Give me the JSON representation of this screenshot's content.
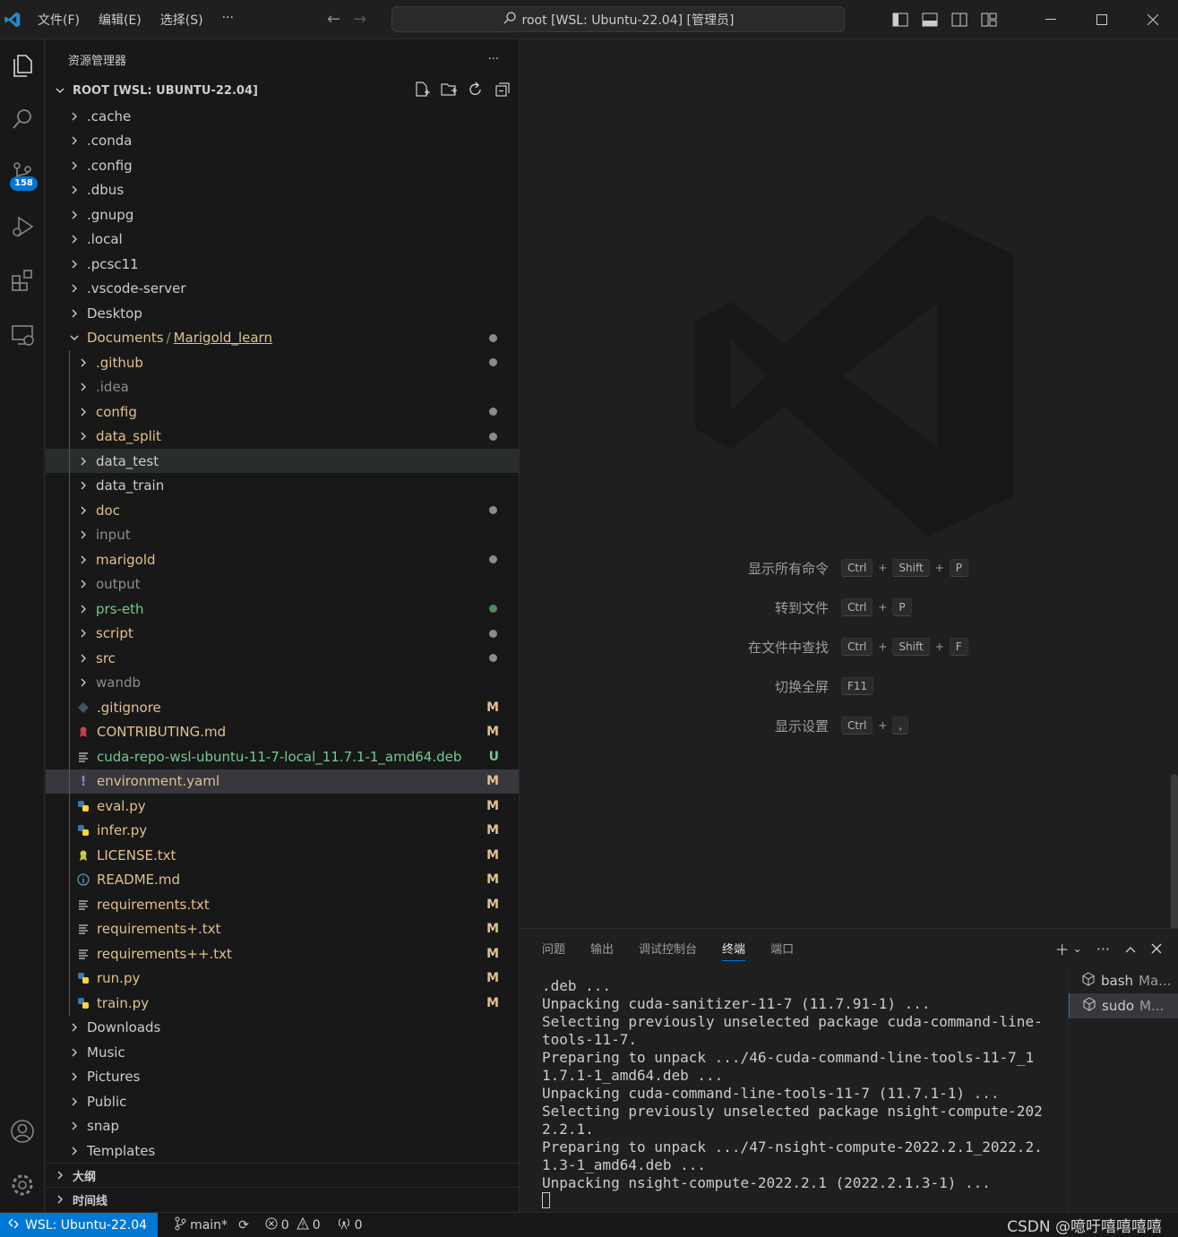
{
  "titlebar": {
    "menus": [
      "文件(F)",
      "编辑(E)",
      "选择(S)",
      "···"
    ],
    "search_text": "root [WSL: Ubuntu-22.04] [管理员]"
  },
  "activity": {
    "scm_badge": "158"
  },
  "explorer": {
    "header": "资源管理器",
    "more": "···",
    "root_label": "ROOT [WSL: UBUNTU-22.04]",
    "items": [
      {
        "label": ".cache",
        "kind": "folder",
        "indent": 0,
        "color": "#cccccc"
      },
      {
        "label": ".conda",
        "kind": "folder",
        "indent": 0,
        "color": "#cccccc"
      },
      {
        "label": ".config",
        "kind": "folder",
        "indent": 0,
        "color": "#cccccc"
      },
      {
        "label": ".dbus",
        "kind": "folder",
        "indent": 0,
        "color": "#cccccc"
      },
      {
        "label": ".gnupg",
        "kind": "folder",
        "indent": 0,
        "color": "#cccccc"
      },
      {
        "label": ".local",
        "kind": "folder",
        "indent": 0,
        "color": "#cccccc"
      },
      {
        "label": ".pcsc11",
        "kind": "folder",
        "indent": 0,
        "color": "#cccccc"
      },
      {
        "label": ".vscode-server",
        "kind": "folder",
        "indent": 0,
        "color": "#cccccc"
      },
      {
        "label": "Desktop",
        "kind": "folder",
        "indent": 0,
        "color": "#cccccc"
      },
      {
        "label": "Documents",
        "label2": "Marigold_learn",
        "kind": "folder-open",
        "indent": 0,
        "color": "#e2c08d",
        "dot": "#8b8b8b"
      },
      {
        "label": ".github",
        "kind": "folder",
        "indent": 1,
        "color": "#e2c08d",
        "dot": "#8b8b8b"
      },
      {
        "label": ".idea",
        "kind": "folder",
        "indent": 1,
        "color": "#8c8c8c"
      },
      {
        "label": "config",
        "kind": "folder",
        "indent": 1,
        "color": "#e2c08d",
        "dot": "#8b8b8b"
      },
      {
        "label": "data_split",
        "kind": "folder",
        "indent": 1,
        "color": "#e2c08d",
        "dot": "#8b8b8b"
      },
      {
        "label": "data_test",
        "kind": "folder",
        "indent": 1,
        "color": "#cccccc",
        "selected": true
      },
      {
        "label": "data_train",
        "kind": "folder",
        "indent": 1,
        "color": "#cccccc"
      },
      {
        "label": "doc",
        "kind": "folder",
        "indent": 1,
        "color": "#e2c08d",
        "dot": "#8b8b8b"
      },
      {
        "label": "input",
        "kind": "folder",
        "indent": 1,
        "color": "#8c8c8c"
      },
      {
        "label": "marigold",
        "kind": "folder",
        "indent": 1,
        "color": "#e2c08d",
        "dot": "#8b8b8b"
      },
      {
        "label": "output",
        "kind": "folder",
        "indent": 1,
        "color": "#8c8c8c"
      },
      {
        "label": "prs-eth",
        "kind": "folder",
        "indent": 1,
        "color": "#73c991",
        "dot": "#4e8a5b"
      },
      {
        "label": "script",
        "kind": "folder",
        "indent": 1,
        "color": "#e2c08d",
        "dot": "#8b8b8b"
      },
      {
        "label": "src",
        "kind": "folder",
        "indent": 1,
        "color": "#e2c08d",
        "dot": "#8b8b8b"
      },
      {
        "label": "wandb",
        "kind": "folder",
        "indent": 1,
        "color": "#8c8c8c"
      },
      {
        "label": ".gitignore",
        "kind": "file",
        "icon": "gitignore",
        "indent": 1,
        "color": "#e2c08d",
        "status": "M"
      },
      {
        "label": "CONTRIBUTING.md",
        "kind": "file",
        "icon": "contrib",
        "indent": 1,
        "color": "#e2c08d",
        "status": "M"
      },
      {
        "label": "cuda-repo-wsl-ubuntu-11-7-local_11.7.1-1_amd64.deb",
        "kind": "file",
        "icon": "lines",
        "indent": 1,
        "color": "#73c991",
        "status": "U",
        "status_color": "#73c991"
      },
      {
        "label": "environment.yaml",
        "kind": "file",
        "icon": "yaml",
        "indent": 1,
        "color": "#e2c08d",
        "status": "M",
        "selected2": true
      },
      {
        "label": "eval.py",
        "kind": "file",
        "icon": "python",
        "indent": 1,
        "color": "#e2c08d",
        "status": "M"
      },
      {
        "label": "infer.py",
        "kind": "file",
        "icon": "python",
        "indent": 1,
        "color": "#e2c08d",
        "status": "M"
      },
      {
        "label": "LICENSE.txt",
        "kind": "file",
        "icon": "license",
        "indent": 1,
        "color": "#e2c08d",
        "status": "M"
      },
      {
        "label": "README.md",
        "kind": "file",
        "icon": "info",
        "indent": 1,
        "color": "#e2c08d",
        "status": "M"
      },
      {
        "label": "requirements.txt",
        "kind": "file",
        "icon": "lines",
        "indent": 1,
        "color": "#e2c08d",
        "status": "M"
      },
      {
        "label": "requirements+.txt",
        "kind": "file",
        "icon": "lines",
        "indent": 1,
        "color": "#e2c08d",
        "status": "M"
      },
      {
        "label": "requirements++.txt",
        "kind": "file",
        "icon": "lines",
        "indent": 1,
        "color": "#e2c08d",
        "status": "M"
      },
      {
        "label": "run.py",
        "kind": "file",
        "icon": "python",
        "indent": 1,
        "color": "#e2c08d",
        "status": "M"
      },
      {
        "label": "train.py",
        "kind": "file",
        "icon": "python",
        "indent": 1,
        "color": "#e2c08d",
        "status": "M"
      },
      {
        "label": "Downloads",
        "kind": "folder",
        "indent": 0,
        "color": "#cccccc"
      },
      {
        "label": "Music",
        "kind": "folder",
        "indent": 0,
        "color": "#cccccc"
      },
      {
        "label": "Pictures",
        "kind": "folder",
        "indent": 0,
        "color": "#cccccc"
      },
      {
        "label": "Public",
        "kind": "folder",
        "indent": 0,
        "color": "#cccccc"
      },
      {
        "label": "snap",
        "kind": "folder",
        "indent": 0,
        "color": "#cccccc"
      },
      {
        "label": "Templates",
        "kind": "folder",
        "indent": 0,
        "color": "#cccccc"
      }
    ],
    "sections": [
      "大纲",
      "时间线"
    ]
  },
  "editor": {
    "shortcuts": [
      {
        "label": "显示所有命令",
        "keys": [
          "Ctrl",
          "Shift",
          "P"
        ]
      },
      {
        "label": "转到文件",
        "keys": [
          "Ctrl",
          "P"
        ]
      },
      {
        "label": "在文件中查找",
        "keys": [
          "Ctrl",
          "Shift",
          "F"
        ]
      },
      {
        "label": "切换全屏",
        "keys": [
          "F11"
        ]
      },
      {
        "label": "显示设置",
        "keys": [
          "Ctrl",
          ","
        ]
      }
    ]
  },
  "panel": {
    "tabs": [
      "问题",
      "输出",
      "调试控制台",
      "终端",
      "端口"
    ],
    "active_tab": "终端",
    "terminal_lines": [
      ".deb ...",
      "Unpacking cuda-sanitizer-11-7 (11.7.91-1) ...",
      "Selecting previously unselected package cuda-command-line-tools-11-7.",
      "Preparing to unpack .../46-cuda-command-line-tools-11-7_11.7.1-1_amd64.deb ...",
      "Unpacking cuda-command-line-tools-11-7 (11.7.1-1) ...",
      "Selecting previously unselected package nsight-compute-2022.2.1.",
      "Preparing to unpack .../47-nsight-compute-2022.2.1_2022.2.1.3-1_amd64.deb ...",
      "Unpacking nsight-compute-2022.2.1 (2022.2.1.3-1) ..."
    ],
    "terminals": [
      {
        "name": "bash",
        "suffix": "Ma..."
      },
      {
        "name": "sudo",
        "suffix": "M..."
      }
    ]
  },
  "statusbar": {
    "remote": "WSL: Ubuntu-22.04",
    "branch": "main*",
    "errors": "0",
    "warnings": "0",
    "ports": "0",
    "watermark": "CSDN @噫吁嘻嘻嘻嘻"
  }
}
